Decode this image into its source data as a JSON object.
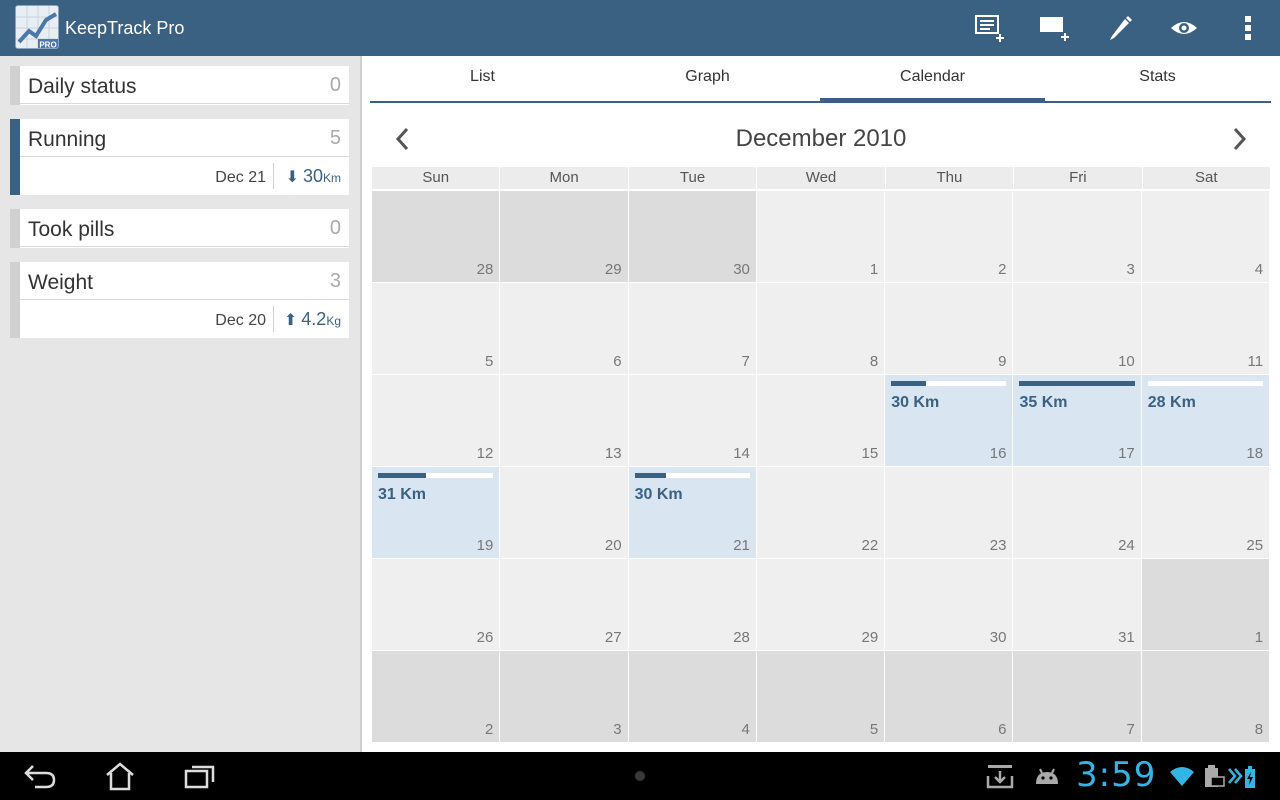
{
  "app": {
    "title": "KeepTrack Pro",
    "icon_badge": "PRO"
  },
  "actions": [
    {
      "name": "add-entry-icon"
    },
    {
      "name": "add-tracker-icon"
    },
    {
      "name": "edit-icon"
    },
    {
      "name": "view-icon"
    },
    {
      "name": "overflow-menu-icon"
    }
  ],
  "trackers": [
    {
      "name": "Daily status",
      "count": "0"
    },
    {
      "name": "Running",
      "count": "5",
      "date": "Dec 21",
      "value": "30",
      "unit": "Km",
      "trend": "down"
    },
    {
      "name": "Took pills",
      "count": "0"
    },
    {
      "name": "Weight",
      "count": "3",
      "date": "Dec 20",
      "value": "4.2",
      "unit": "Kg",
      "trend": "up"
    }
  ],
  "tabs": [
    "List",
    "Graph",
    "Calendar",
    "Stats"
  ],
  "active_tab": "Calendar",
  "calendar": {
    "month_title": "December 2010",
    "weekdays": [
      "Sun",
      "Mon",
      "Tue",
      "Wed",
      "Thu",
      "Fri",
      "Sat"
    ],
    "weeks": [
      [
        {
          "d": "28",
          "o": true
        },
        {
          "d": "29",
          "o": true
        },
        {
          "d": "30",
          "o": true
        },
        {
          "d": "1"
        },
        {
          "d": "2"
        },
        {
          "d": "3"
        },
        {
          "d": "4"
        }
      ],
      [
        {
          "d": "5"
        },
        {
          "d": "6"
        },
        {
          "d": "7"
        },
        {
          "d": "8"
        },
        {
          "d": "9"
        },
        {
          "d": "10"
        },
        {
          "d": "11"
        }
      ],
      [
        {
          "d": "12"
        },
        {
          "d": "13"
        },
        {
          "d": "14"
        },
        {
          "d": "15"
        },
        {
          "d": "16",
          "e": "30 Km",
          "p": 0.3
        },
        {
          "d": "17",
          "e": "35 Km",
          "p": 1.0
        },
        {
          "d": "18",
          "e": "28 Km",
          "p": 0.0
        }
      ],
      [
        {
          "d": "19",
          "e": "31 Km",
          "p": 0.42
        },
        {
          "d": "20"
        },
        {
          "d": "21",
          "e": "30 Km",
          "p": 0.27
        },
        {
          "d": "22"
        },
        {
          "d": "23"
        },
        {
          "d": "24"
        },
        {
          "d": "25"
        }
      ],
      [
        {
          "d": "26"
        },
        {
          "d": "27"
        },
        {
          "d": "28"
        },
        {
          "d": "29"
        },
        {
          "d": "30"
        },
        {
          "d": "31"
        },
        {
          "d": "1",
          "o": true
        }
      ],
      [
        {
          "d": "2",
          "o": true
        },
        {
          "d": "3",
          "o": true
        },
        {
          "d": "4",
          "o": true
        },
        {
          "d": "5",
          "o": true
        },
        {
          "d": "6",
          "o": true
        },
        {
          "d": "7",
          "o": true
        },
        {
          "d": "8",
          "o": true
        }
      ]
    ]
  },
  "status_bar": {
    "time": "3:59"
  },
  "colors": {
    "accent": "#3a6182",
    "entry_bg": "#d9e6f2",
    "clock": "#33b5e5"
  }
}
